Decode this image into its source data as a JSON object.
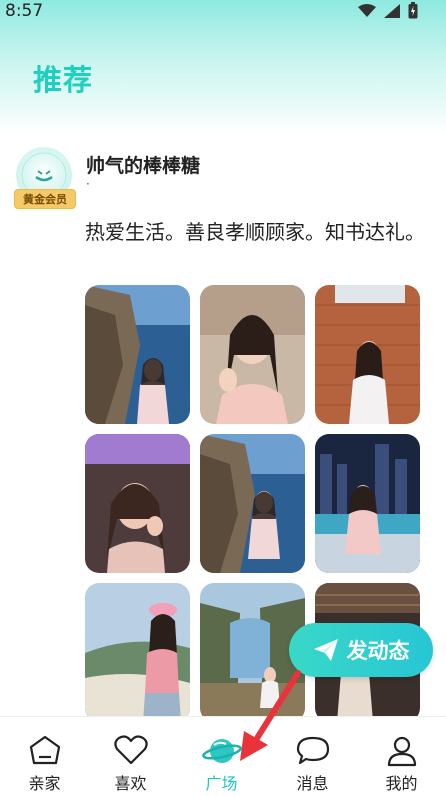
{
  "status": {
    "time": "8:57"
  },
  "header": {
    "title": "推荐"
  },
  "post": {
    "username": "帅气的棒棒糖",
    "subline": "·",
    "badge": "黄金会员",
    "text": "热爱生活。善良孝顺顾家。知书达礼。"
  },
  "fab": {
    "label": "发动态",
    "icon": "paper-plane-icon"
  },
  "tabs": [
    {
      "label": "亲家",
      "icon": "home-icon",
      "active": false
    },
    {
      "label": "喜欢",
      "icon": "heart-icon",
      "active": false
    },
    {
      "label": "广场",
      "icon": "planet-icon",
      "active": true
    },
    {
      "label": "消息",
      "icon": "chat-bubble-icon",
      "active": false
    },
    {
      "label": "我的",
      "icon": "person-icon",
      "active": false
    }
  ],
  "colors": {
    "accent": "#1fd0c0",
    "active_tab": "#1fc7c0",
    "badge": "#f4c96a",
    "arrow": "#e8323c"
  }
}
